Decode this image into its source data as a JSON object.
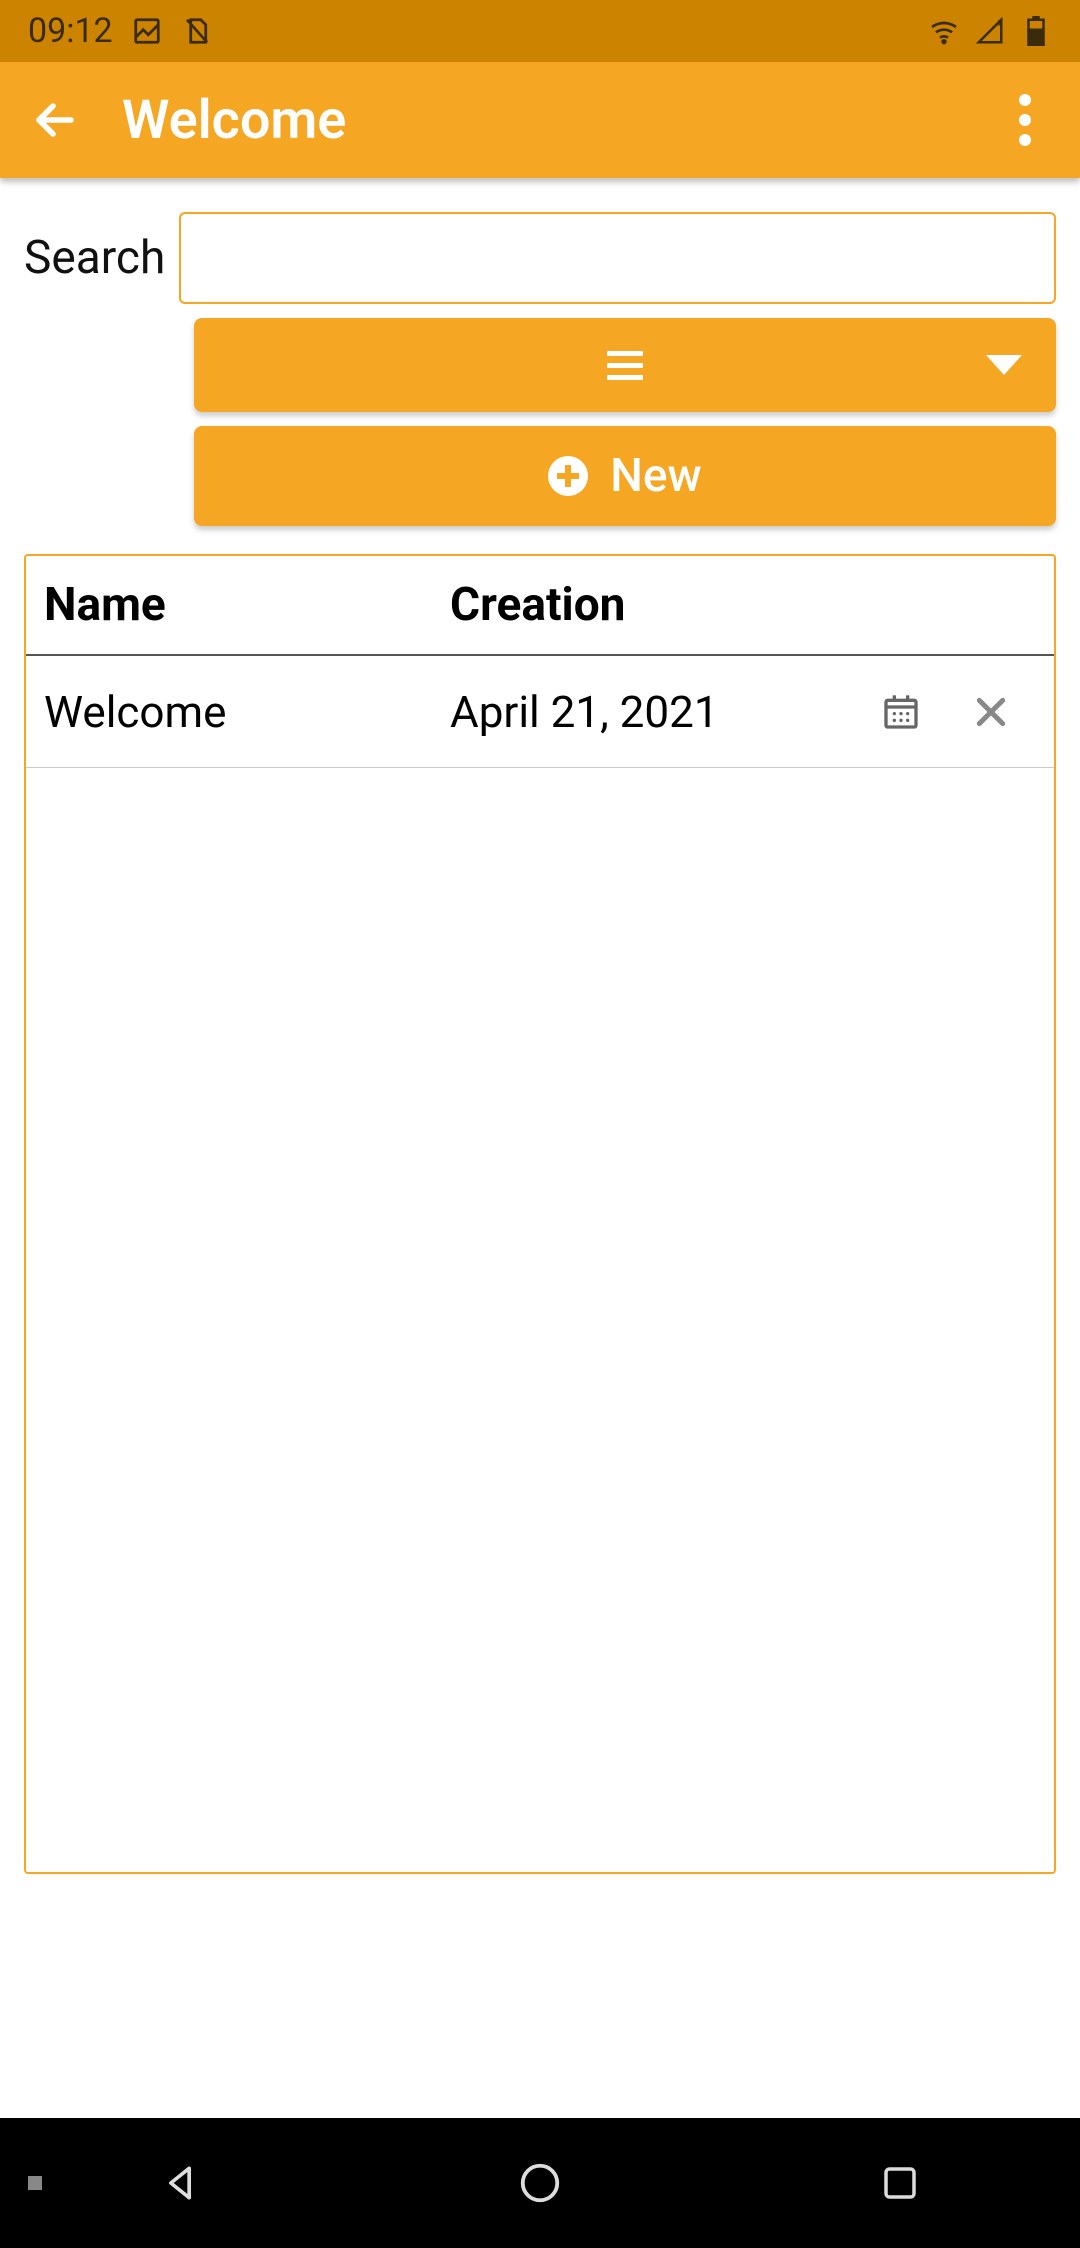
{
  "status": {
    "time": "09:12"
  },
  "appbar": {
    "title": "Welcome"
  },
  "search": {
    "label": "Search",
    "value": ""
  },
  "buttons": {
    "new_label": "New"
  },
  "table": {
    "headers": {
      "name": "Name",
      "creation": "Creation"
    },
    "rows": [
      {
        "name": "Welcome",
        "creation": "April 21, 2021"
      }
    ]
  },
  "colors": {
    "accent": "#f5a623",
    "status_bg": "#cc8400"
  }
}
